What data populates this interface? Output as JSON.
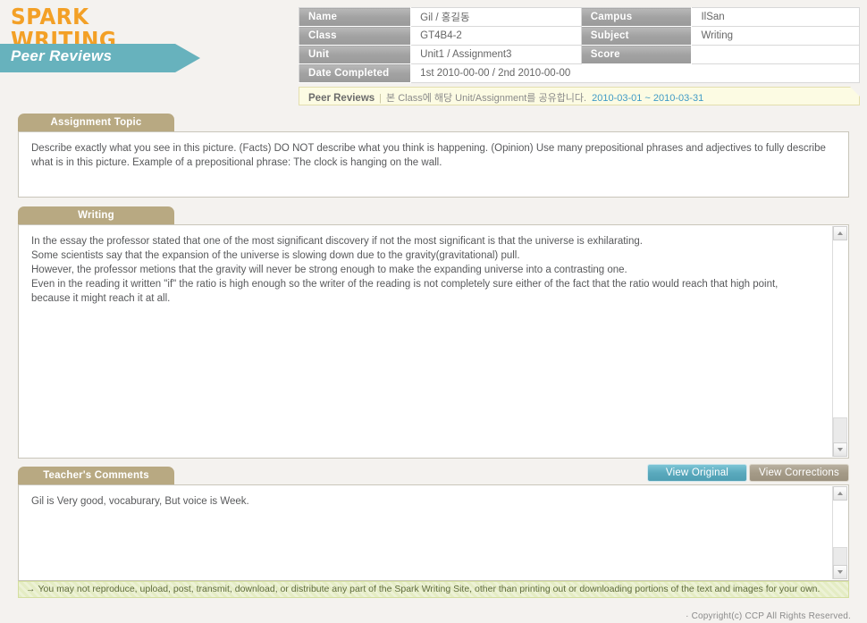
{
  "brand": {
    "logo_line1": "SPARK",
    "logo_line2": "WRITING",
    "banner_label": "Peer Reviews",
    "logo_color": "#f3a026",
    "banner_color": "#67b2bd"
  },
  "info": {
    "rows": [
      {
        "label": "Name",
        "value": "Gil / 홍길동",
        "label2": "Campus",
        "value2": "IlSan"
      },
      {
        "label": "Class",
        "value": "GT4B4-2",
        "label2": "Subject",
        "value2": "Writing"
      },
      {
        "label": "Unit",
        "value": "Unit1 / Assignment3",
        "label2": "Score",
        "value2": ""
      }
    ],
    "date_label": "Date Completed",
    "date_value": "1st 2010-00-00 / 2nd 2010-00-00"
  },
  "notice": {
    "title": "Peer Reviews",
    "separator": "|",
    "body": "본 Class에 해당 Unit/Assignment를 공유합니다.",
    "date_range": "2010-03-01 ~ 2010-03-31",
    "date_color": "#3f9ac6"
  },
  "sections": {
    "assignment_topic": {
      "tab_label": "Assignment Topic",
      "body": "Describe exactly what you see in this picture. (Facts) DO NOT describe what you think is happening. (Opinion) Use many prepositional phrases and adjectives to fully describe what is in this picture. Example of a prepositional phrase: The clock is hanging on the wall."
    },
    "writing": {
      "tab_label": "Writing",
      "lines": [
        "In the essay the professor stated that one of the most significant discovery if not the most significant is that the universe is exhilarating.",
        "Some scientists say that the expansion of the universe is slowing down due to the gravity(gravitational) pull.",
        "However, the professor metions that the gravity will never be strong enough to make the expanding universe into a contrasting one.",
        "Even in the reading it written \"if\" the ratio is high enough so the writer of the reading is not completely sure either of the fact that the ratio would reach that high point, because it might reach it at all."
      ]
    },
    "teacher_comments": {
      "tab_label": "Teacher's Comments",
      "body": "Gil is Very good, vocaburary, But voice is Week."
    }
  },
  "buttons": {
    "view_original": "View Original",
    "view_corrections": "View Corrections",
    "active_color": "#5aa9bd",
    "alt_color": "#a49a87"
  },
  "footer": {
    "arrow": "→",
    "notice": "You may not reproduce, upload, post, transmit, download, or distribute any part of the Spark Writing Site, other than printing out or downloading portions of the text and images for your own.",
    "copyright": "· Copyright(c) CCP All Rights Reserved."
  }
}
